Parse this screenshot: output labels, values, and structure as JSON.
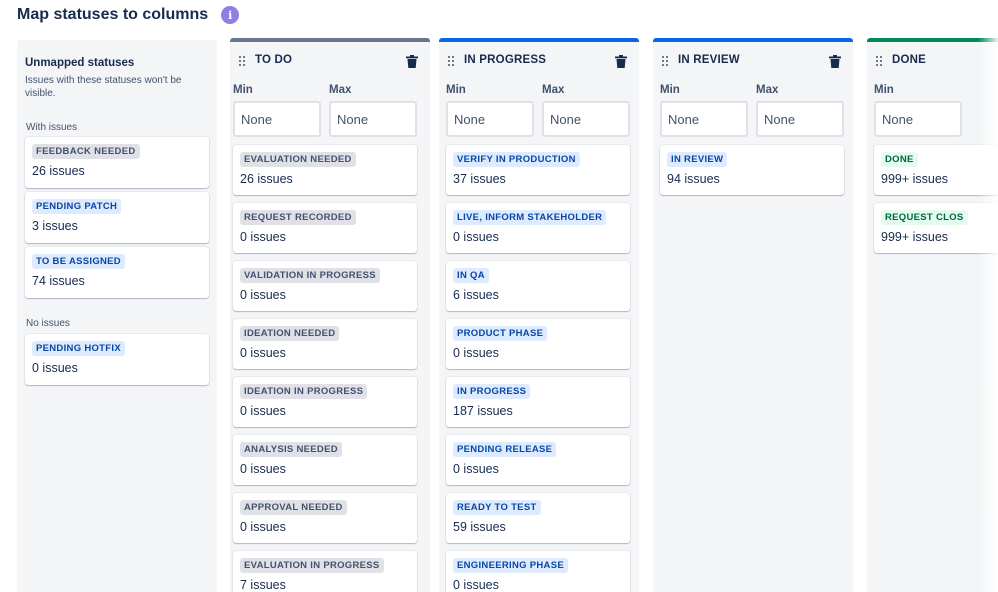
{
  "header": {
    "title": "Map statuses to columns",
    "info_icon": "info-icon"
  },
  "colors": {
    "todo_bar": "#6b778c",
    "blue_bar": "#0c66e4",
    "done_bar": "#00875a",
    "info": "#8f7ee7"
  },
  "unmapped": {
    "title": "Unmapped statuses",
    "description": "Issues with these statuses won't be visible.",
    "with_issues_label": "With issues",
    "no_issues_label": "No issues",
    "with_issues": [
      {
        "status": "FEEDBACK NEEDED",
        "count": "26 issues"
      },
      {
        "status": "PENDING PATCH",
        "count": "3 issues"
      },
      {
        "status": "TO BE ASSIGNED",
        "count": "74 issues"
      }
    ],
    "no_issues": [
      {
        "status": "PENDING HOTFIX",
        "count": "0 issues"
      }
    ]
  },
  "limits": {
    "min_label": "Min",
    "max_label": "Max",
    "placeholder": "None"
  },
  "columns": [
    {
      "name": "TO DO",
      "cards": [
        {
          "status": "EVALUATION NEEDED",
          "count": "26 issues"
        },
        {
          "status": "REQUEST RECORDED",
          "count": "0 issues"
        },
        {
          "status": "VALIDATION IN PROGRESS",
          "count": "0 issues"
        },
        {
          "status": "IDEATION NEEDED",
          "count": "0 issues"
        },
        {
          "status": "IDEATION IN PROGRESS",
          "count": "0 issues"
        },
        {
          "status": "ANALYSIS NEEDED",
          "count": "0 issues"
        },
        {
          "status": "APPROVAL NEEDED",
          "count": "0 issues"
        },
        {
          "status": "EVALUATION IN PROGRESS",
          "count": "7 issues"
        }
      ]
    },
    {
      "name": "IN PROGRESS",
      "cards": [
        {
          "status": "VERIFY IN PRODUCTION",
          "count": "37 issues"
        },
        {
          "status": "LIVE, INFORM STAKEHOLDER",
          "count": "0 issues"
        },
        {
          "status": "IN QA",
          "count": "6 issues"
        },
        {
          "status": "PRODUCT PHASE",
          "count": "0 issues"
        },
        {
          "status": "IN PROGRESS",
          "count": "187 issues"
        },
        {
          "status": "PENDING RELEASE",
          "count": "0 issues"
        },
        {
          "status": "READY TO TEST",
          "count": "59 issues"
        },
        {
          "status": "ENGINEERING PHASE",
          "count": "0 issues"
        }
      ]
    },
    {
      "name": "IN REVIEW",
      "cards": [
        {
          "status": "IN REVIEW",
          "count": "94 issues"
        }
      ]
    },
    {
      "name": "DONE",
      "cards": [
        {
          "status": "DONE",
          "count": "999+ issues"
        },
        {
          "status": "REQUEST CLOS",
          "count": "999+ issues"
        }
      ]
    }
  ]
}
